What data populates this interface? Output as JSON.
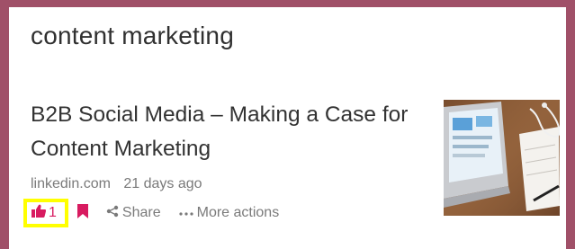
{
  "search": {
    "query": "content marketing"
  },
  "result": {
    "title": "B2B Social Media – Making a Case for Content Marketing",
    "source": "linkedin.com",
    "age": "21 days ago",
    "thumbnail_icon": "laptop-desk-photo"
  },
  "actions": {
    "like_count": "1",
    "like_icon": "thumbs-up-icon",
    "bookmark_icon": "bookmark-icon",
    "share_label": "Share",
    "share_icon": "share-icon",
    "more_label": "More actions",
    "more_icon": "ellipsis-icon"
  },
  "colors": {
    "frame": "#a05068",
    "accent": "#d81b60",
    "highlight": "#ffff00",
    "meta_text": "#7a7a7a"
  }
}
